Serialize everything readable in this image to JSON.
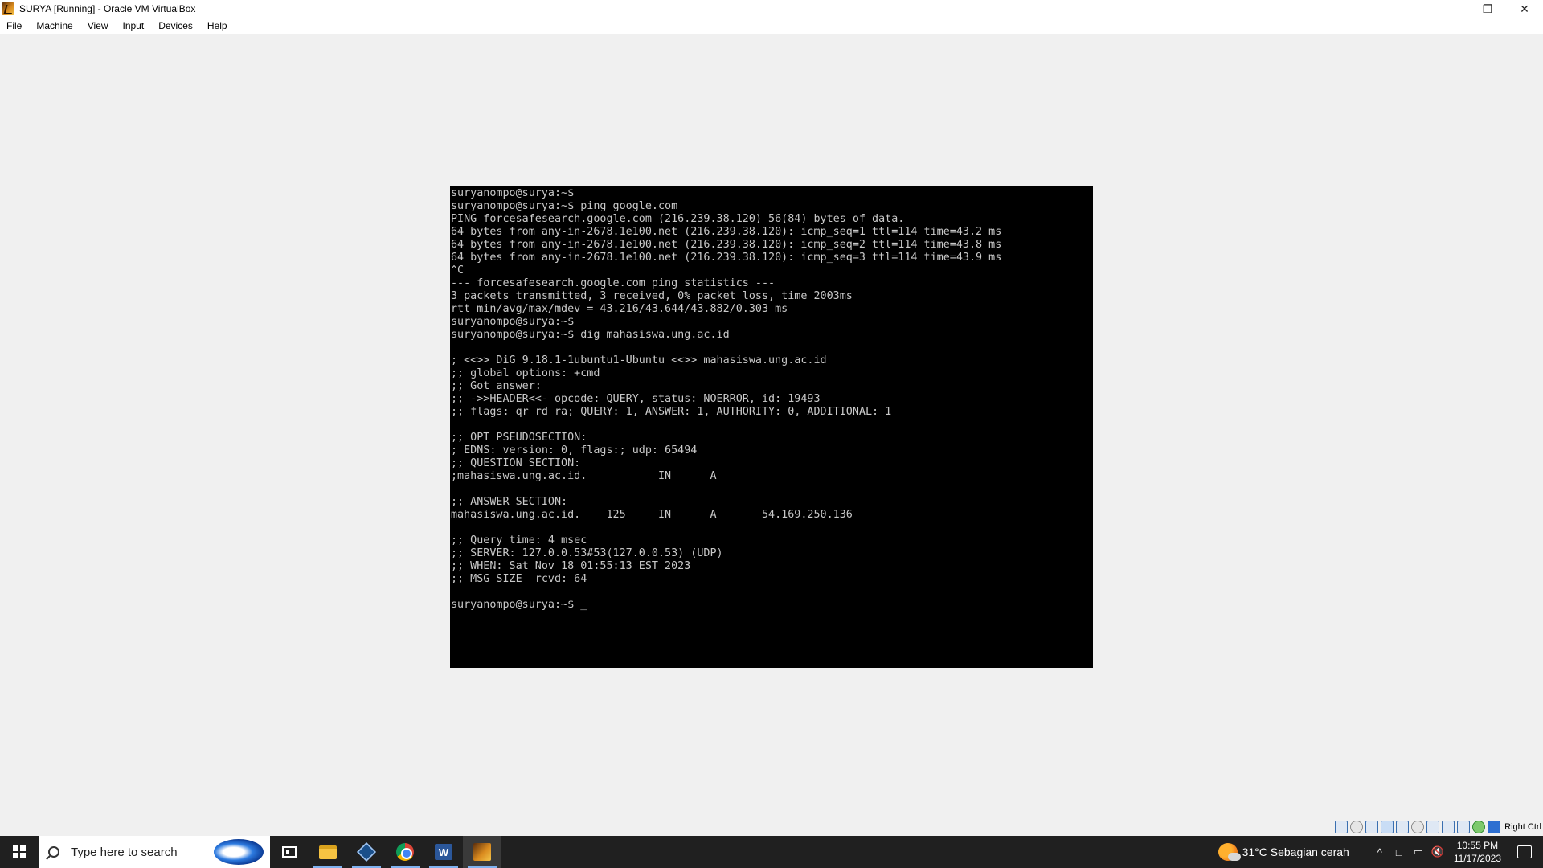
{
  "window": {
    "title": "SURYA [Running] - Oracle VM VirtualBox",
    "minimize_glyph": "—",
    "restore_glyph": "❐",
    "close_glyph": "✕"
  },
  "menu": {
    "items": [
      "File",
      "Machine",
      "View",
      "Input",
      "Devices",
      "Help"
    ]
  },
  "terminal": {
    "lines": [
      "suryanompo@surya:~$",
      "suryanompo@surya:~$ ping google.com",
      "PING forcesafesearch.google.com (216.239.38.120) 56(84) bytes of data.",
      "64 bytes from any-in-2678.1e100.net (216.239.38.120): icmp_seq=1 ttl=114 time=43.2 ms",
      "64 bytes from any-in-2678.1e100.net (216.239.38.120): icmp_seq=2 ttl=114 time=43.8 ms",
      "64 bytes from any-in-2678.1e100.net (216.239.38.120): icmp_seq=3 ttl=114 time=43.9 ms",
      "^C",
      "--- forcesafesearch.google.com ping statistics ---",
      "3 packets transmitted, 3 received, 0% packet loss, time 2003ms",
      "rtt min/avg/max/mdev = 43.216/43.644/43.882/0.303 ms",
      "suryanompo@surya:~$",
      "suryanompo@surya:~$ dig mahasiswa.ung.ac.id",
      "",
      "; <<>> DiG 9.18.1-1ubuntu1-Ubuntu <<>> mahasiswa.ung.ac.id",
      ";; global options: +cmd",
      ";; Got answer:",
      ";; ->>HEADER<<- opcode: QUERY, status: NOERROR, id: 19493",
      ";; flags: qr rd ra; QUERY: 1, ANSWER: 1, AUTHORITY: 0, ADDITIONAL: 1",
      "",
      ";; OPT PSEUDOSECTION:",
      "; EDNS: version: 0, flags:; udp: 65494",
      ";; QUESTION SECTION:",
      ";mahasiswa.ung.ac.id.           IN      A",
      "",
      ";; ANSWER SECTION:",
      "mahasiswa.ung.ac.id.    125     IN      A       54.169.250.136",
      "",
      ";; Query time: 4 msec",
      ";; SERVER: 127.0.0.53#53(127.0.0.53) (UDP)",
      ";; WHEN: Sat Nov 18 01:55:13 EST 2023",
      ";; MSG SIZE  rcvd: 64",
      ""
    ],
    "prompt": "suryanompo@surya:~$ ",
    "cursor": "_"
  },
  "vbox_status": {
    "host_key": "Right Ctrl"
  },
  "taskbar": {
    "search_placeholder": "Type here to search",
    "word_letter": "W"
  },
  "tray": {
    "weather": "31°C  Sebagian cerah",
    "chevron": "^",
    "time": "10:55 PM",
    "date": "11/17/2023"
  }
}
